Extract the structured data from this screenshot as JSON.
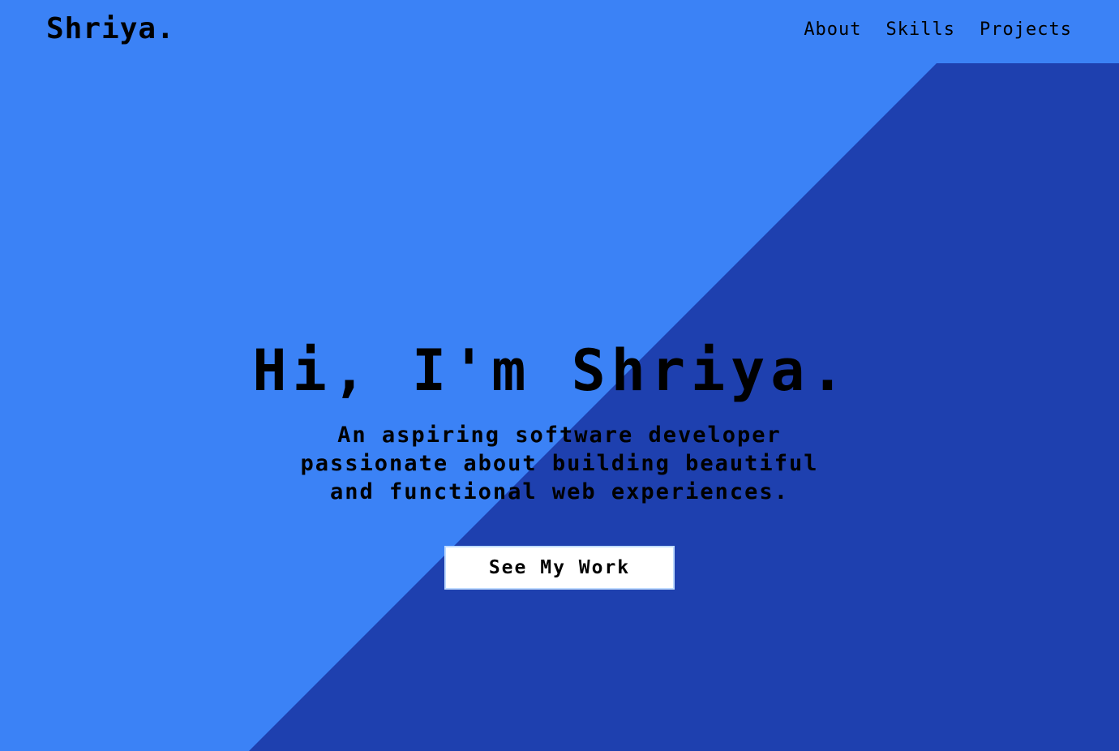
{
  "theme": {
    "background_light": "#3b82f6",
    "background_dark": "#1e40af",
    "button_bg": "#ffffff",
    "text": "#000000"
  },
  "header": {
    "logo": "Shriya.",
    "nav": [
      {
        "label": "About"
      },
      {
        "label": "Skills"
      },
      {
        "label": "Projects"
      }
    ]
  },
  "hero": {
    "title": "Hi, I'm Shriya.",
    "subtitle_lines": [
      "An aspiring software developer",
      "passionate about building beautiful",
      "and functional web experiences."
    ],
    "cta_label": "See My Work"
  }
}
